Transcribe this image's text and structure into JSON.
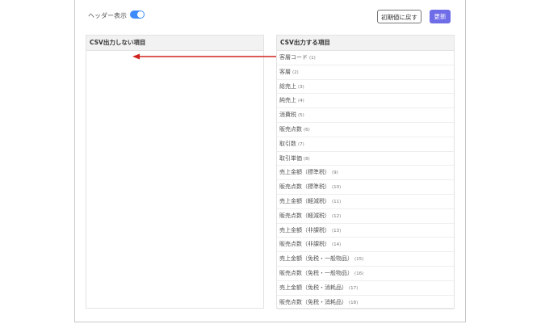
{
  "toolbar": {
    "header_toggle_label": "ヘッダー表示",
    "header_toggle_on": true,
    "reset_label": "初期値に戻す",
    "update_label": "更新"
  },
  "excluded_panel": {
    "title": "CSV出力しない項目",
    "items": []
  },
  "included_panel": {
    "title": "CSV出力する項目",
    "items": [
      {
        "label": "客層コード",
        "num": "(1)"
      },
      {
        "label": "客層",
        "num": "(2)"
      },
      {
        "label": "総売上",
        "num": "(3)"
      },
      {
        "label": "純売上",
        "num": "(4)"
      },
      {
        "label": "消費税",
        "num": "(5)"
      },
      {
        "label": "販売点数",
        "num": "(6)"
      },
      {
        "label": "取引数",
        "num": "(7)"
      },
      {
        "label": "取引単価",
        "num": "(8)"
      },
      {
        "label": "売上金額（標準税）",
        "num": "(9)"
      },
      {
        "label": "販売点数（標準税）",
        "num": "(10)"
      },
      {
        "label": "売上金額（軽減税）",
        "num": "(11)"
      },
      {
        "label": "販売点数（軽減税）",
        "num": "(12)"
      },
      {
        "label": "売上金額（非課税）",
        "num": "(13)"
      },
      {
        "label": "販売点数（非課税）",
        "num": "(14)"
      },
      {
        "label": "売上金額（免税・一般物品）",
        "num": "(15)"
      },
      {
        "label": "販売点数（免税・一般物品）",
        "num": "(16)"
      },
      {
        "label": "売上金額（免税・消耗品）",
        "num": "(17)"
      },
      {
        "label": "販売点数（免税・消耗品）",
        "num": "(18)"
      }
    ]
  },
  "colors": {
    "toggle_on": "#3d8bfd",
    "update_button": "#6f6ce8",
    "drag_arrow": "#d0231f"
  }
}
